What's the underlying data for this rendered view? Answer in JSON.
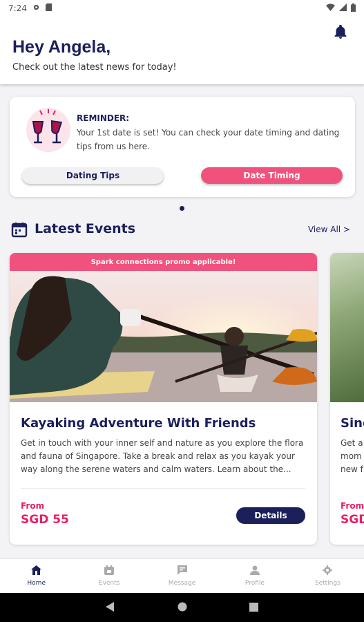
{
  "status_bar": {
    "time": "7:24"
  },
  "header": {
    "greeting": "Hey Angela,",
    "subtitle": "Check out the latest news for today!"
  },
  "reminder": {
    "title": "REMINDER:",
    "text": "Your 1st date is set! You can check your date timing and dating tips from us here.",
    "tips_button": "Dating Tips",
    "timing_button": "Date Timing"
  },
  "events_section": {
    "title": "Latest Events",
    "view_all": "View All >"
  },
  "events": [
    {
      "promo": "Spark connections promo applicable!",
      "title": "Kayaking Adventure With Friends",
      "description": "Get in touch with your inner self and nature as you explore the flora and fauna of Singapore. Take a break and relax as you kayak your way along the serene waters and calm waters. Learn about the...",
      "from_label": "From",
      "price": "SGD 55",
      "details_button": "Details"
    },
    {
      "title_partial": "Sing",
      "desc_partial": [
        "Get a",
        "mom",
        "new f"
      ],
      "from_label": "From",
      "price_partial": "SGD"
    }
  ],
  "bottom_nav": [
    {
      "label": "Home",
      "icon": "home-icon",
      "active": true
    },
    {
      "label": "Events",
      "icon": "calendar-icon",
      "active": false
    },
    {
      "label": "Message",
      "icon": "message-icon",
      "active": false
    },
    {
      "label": "Profile",
      "icon": "person-icon",
      "active": false
    },
    {
      "label": "Settings",
      "icon": "gear-icon",
      "active": false
    }
  ],
  "colors": {
    "navy": "#1b1f5a",
    "pink": "#f0527d",
    "price": "#e91e63"
  }
}
